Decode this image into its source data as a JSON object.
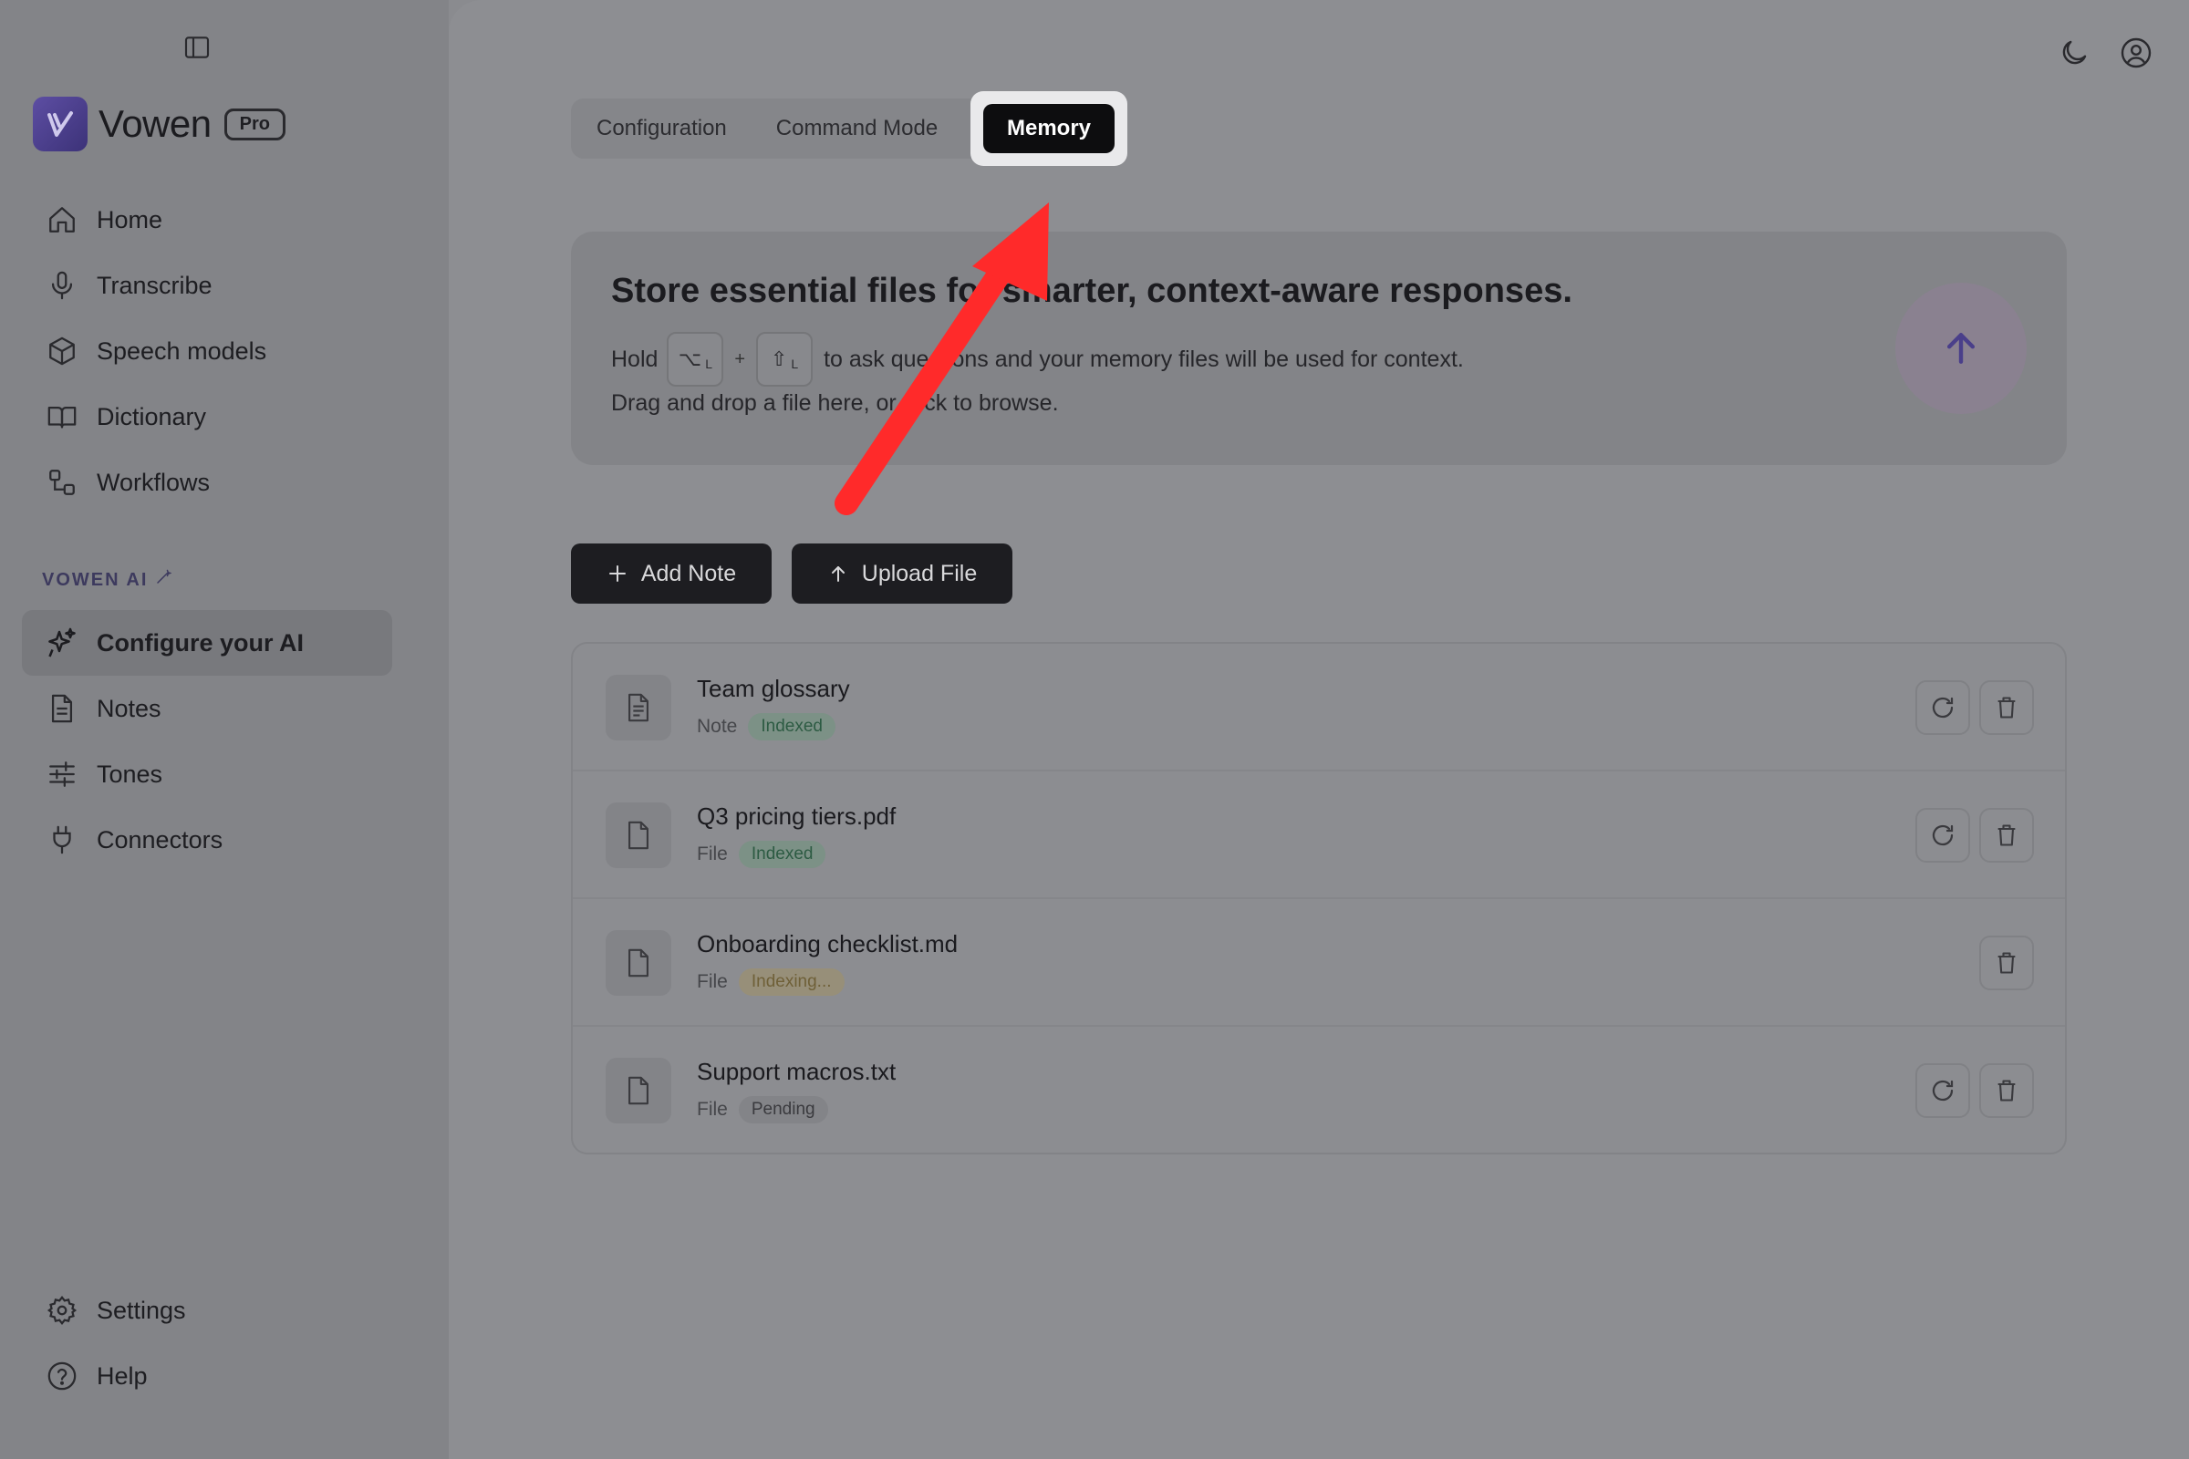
{
  "app": {
    "name": "Vowen",
    "plan_badge": "Pro"
  },
  "sidebar": {
    "items": [
      {
        "label": "Home",
        "icon": "home-icon"
      },
      {
        "label": "Transcribe",
        "icon": "microphone-icon"
      },
      {
        "label": "Speech models",
        "icon": "cube-icon"
      },
      {
        "label": "Dictionary",
        "icon": "book-icon"
      },
      {
        "label": "Workflows",
        "icon": "workflow-icon"
      }
    ],
    "section_label": "VOWEN AI",
    "ai_items": [
      {
        "label": "Configure your AI",
        "icon": "sparkles-icon",
        "active": true
      },
      {
        "label": "Notes",
        "icon": "document-icon"
      },
      {
        "label": "Tones",
        "icon": "sliders-icon"
      },
      {
        "label": "Connectors",
        "icon": "plug-icon"
      }
    ],
    "bottom_items": [
      {
        "label": "Settings",
        "icon": "gear-icon"
      },
      {
        "label": "Help",
        "icon": "help-icon"
      }
    ]
  },
  "tabs": [
    "Configuration",
    "Command Mode",
    "Memory"
  ],
  "active_tab": "Memory",
  "dropzone": {
    "title": "Store essential files for smarter, context-aware responses.",
    "hold": "Hold",
    "key1": "⌥",
    "key1_sub": "L",
    "plus": "+",
    "key2": "⇧",
    "key2_sub": "L",
    "line1_rest": "to ask questions and your memory files will be used for context.",
    "line2": "Drag and drop a file here, or click to browse."
  },
  "actions": {
    "add_note": "Add Note",
    "upload_file": "Upload File"
  },
  "files": [
    {
      "name": "Team glossary",
      "type": "Note",
      "status": "Indexed",
      "status_kind": "indexed",
      "refresh": true,
      "icon": "note-icon"
    },
    {
      "name": "Q3 pricing tiers.pdf",
      "type": "File",
      "status": "Indexed",
      "status_kind": "indexed",
      "refresh": true,
      "icon": "file-icon"
    },
    {
      "name": "Onboarding checklist.md",
      "type": "File",
      "status": "Indexing...",
      "status_kind": "indexing",
      "refresh": false,
      "icon": "file-icon"
    },
    {
      "name": "Support macros.txt",
      "type": "File",
      "status": "Pending",
      "status_kind": "pending",
      "refresh": true,
      "icon": "file-icon"
    }
  ],
  "colors": {
    "accent": "#5d4ea3",
    "annotation_arrow": "#ff2a2a",
    "badge_indexed": "#2d5b43",
    "badge_indexing": "#6f6038"
  }
}
